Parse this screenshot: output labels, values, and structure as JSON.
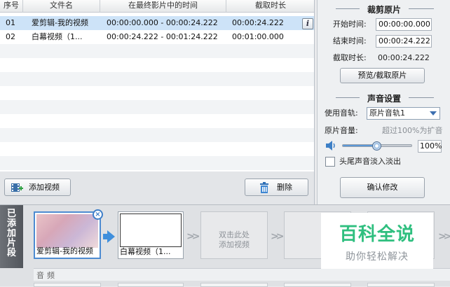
{
  "list": {
    "columns": [
      "序号",
      "文件名",
      "在最终影片中的时间",
      "截取时长"
    ],
    "rows": [
      {
        "index": "01",
        "name": "爱剪辑-我的视频",
        "time": "00:00:00.000 - 00:00:24.222",
        "duration": "00:00:24.222"
      },
      {
        "index": "02",
        "name": "白幕视频（1...",
        "time": "00:00:24.222 - 00:01:24.222",
        "duration": "00:01:00.000"
      }
    ],
    "info_icon": "i"
  },
  "toolbar": {
    "add_label": "添加视频",
    "delete_label": "删除"
  },
  "settings": {
    "crop": {
      "title": "裁剪原片",
      "start_label": "开始时间:",
      "start_value": "00:00:00.000",
      "end_label": "结束时间:",
      "end_value": "00:00:24.222",
      "duration_label": "截取时长:",
      "duration_value": "00:00:24.222",
      "preview_button": "预览/截取原片"
    },
    "audio": {
      "title": "声音设置",
      "track_label": "使用音轨:",
      "track_value": "原片音轨1",
      "volume_label": "原片音量:",
      "volume_hint": "超过100%为扩音",
      "volume_value": "100%",
      "volume_level": 0.5,
      "fade_label": "头尾声音淡入淡出",
      "confirm_button": "确认修改"
    }
  },
  "timeline": {
    "tab_chars": [
      "已",
      "添",
      "加",
      "片",
      "段"
    ],
    "clips": [
      {
        "name": "爱剪辑-我的视频"
      },
      {
        "name": "白幕视频（1..."
      }
    ],
    "placeholder_lines": [
      "双击此处",
      "添加视频"
    ],
    "audio_label": "音频"
  },
  "watermark": {
    "main": "百科全说",
    "sub": "助你轻松解决"
  },
  "colors": {
    "accent": "#3f8fdc",
    "selected_row": "#cde3f8",
    "watermark": "#2fbf7f"
  }
}
